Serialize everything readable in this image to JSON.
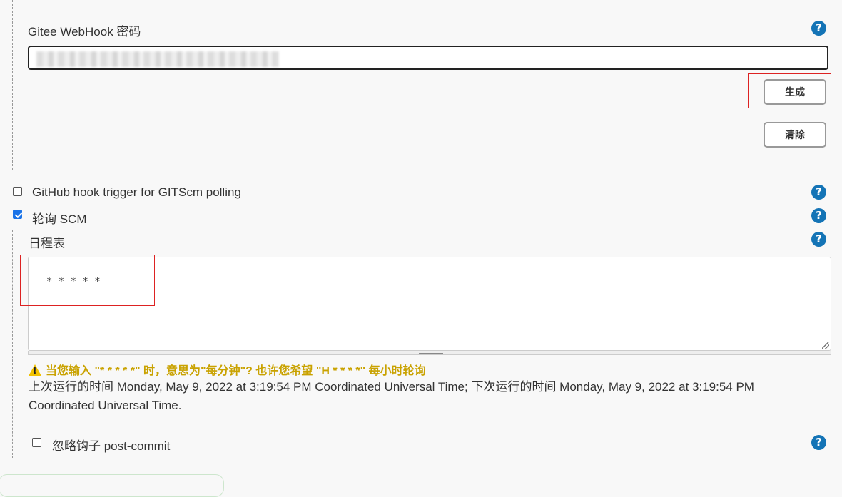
{
  "webhook": {
    "label": "Gitee WebHook 密码",
    "generate_label": "生成",
    "clear_label": "清除"
  },
  "triggers": {
    "github_hook_label": "GitHub hook trigger for GITScm polling",
    "github_hook_checked": false,
    "poll_scm_label": "轮询 SCM",
    "poll_scm_checked": true
  },
  "schedule": {
    "label": "日程表",
    "value": "* * * * *",
    "warning": "当您输入 \"* * * * *\" 时，意思为\"每分钟\"? 也许您希望 \"H * * * *\" 每小时轮询",
    "run_info": "上次运行的时间 Monday, May 9, 2022 at 3:19:54 PM Coordinated Universal Time; 下次运行的时间 Monday, May 9, 2022 at 3:19:54 PM Coordinated Universal Time."
  },
  "post_commit": {
    "label": "忽略钩子 post-commit",
    "checked": false
  },
  "help_icon_glyph": "?",
  "colors": {
    "help_icon": "#1474b6",
    "warning_text": "#c9a200",
    "highlight_box": "#dd2222",
    "checkbox_checked": "#1a73e8"
  }
}
